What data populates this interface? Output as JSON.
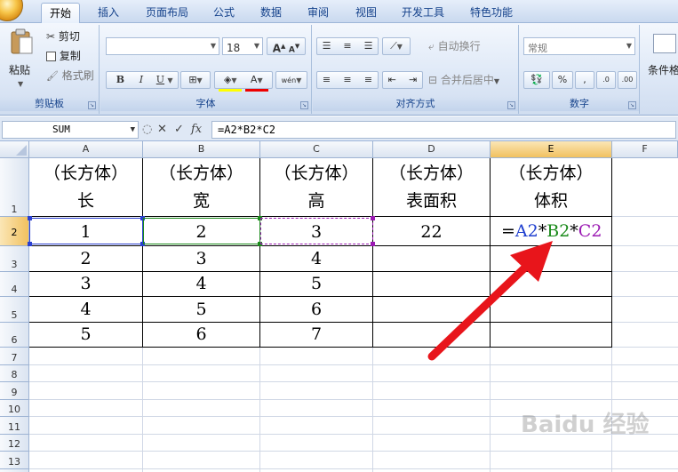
{
  "tabs": [
    {
      "label": "开始",
      "active": true
    },
    {
      "label": "插入"
    },
    {
      "label": "页面布局"
    },
    {
      "label": "公式"
    },
    {
      "label": "数据"
    },
    {
      "label": "审阅"
    },
    {
      "label": "视图"
    },
    {
      "label": "开发工具"
    },
    {
      "label": "特色功能"
    }
  ],
  "ribbon": {
    "clipboard": {
      "label": "剪贴板",
      "paste": "粘贴",
      "cut": "剪切",
      "copy": "复制",
      "format_painter": "格式刷"
    },
    "font": {
      "label": "字体",
      "font_name": "",
      "font_size": "18",
      "grow": "A",
      "shrink": "A",
      "bold": "B",
      "italic": "I",
      "underline": "U",
      "phonetic": "wén"
    },
    "alignment": {
      "label": "对齐方式",
      "wrap_text": "自动换行",
      "merge_center": "合并后居中"
    },
    "number": {
      "label": "数字",
      "format": "常规",
      "percent": "%",
      "comma": ",",
      "inc_decimal": ".0",
      "dec_decimal": ".00"
    },
    "styles": {
      "conditional": "条件格式"
    }
  },
  "formula_bar": {
    "name_box": "SUM",
    "cancel": "✕",
    "enter": "✓",
    "fx": "fx",
    "formula": "=A2*B2*C2"
  },
  "columns": [
    "A",
    "B",
    "C",
    "D",
    "E",
    "F"
  ],
  "rows": [
    "1",
    "2",
    "3",
    "4",
    "5",
    "6",
    "7",
    "8",
    "9",
    "10",
    "11",
    "12",
    "13"
  ],
  "header_row": [
    {
      "line1": "（长方体）",
      "line2": "长"
    },
    {
      "line1": "（长方体）",
      "line2": "宽"
    },
    {
      "line1": "（长方体）",
      "line2": "高"
    },
    {
      "line1": "（长方体）",
      "line2": "表面积"
    },
    {
      "line1": "（长方体）",
      "line2": "体积"
    }
  ],
  "data_rows": [
    [
      "1",
      "2",
      "3",
      "22",
      ""
    ],
    [
      "2",
      "3",
      "4",
      "",
      ""
    ],
    [
      "3",
      "4",
      "5",
      "",
      ""
    ],
    [
      "4",
      "5",
      "6",
      "",
      ""
    ],
    [
      "5",
      "6",
      "7",
      "",
      ""
    ]
  ],
  "editing_formula": {
    "eq": "=",
    "ref1": "A2",
    "op1": "*",
    "ref2": "B2",
    "op2": "*",
    "ref3": "C2"
  },
  "colors": {
    "ref1": "#1f3fcf",
    "ref2": "#1a8a1a",
    "ref3": "#9b1ab3",
    "arrow": "#e8151b"
  },
  "watermark": "Baidu 经验"
}
